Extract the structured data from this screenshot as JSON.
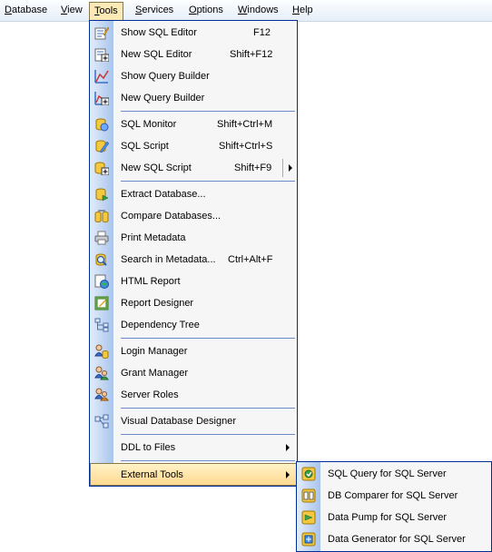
{
  "menubar": {
    "items": [
      {
        "accel": "D",
        "rest": "atabase"
      },
      {
        "accel": "V",
        "rest": "iew"
      },
      {
        "accel": "T",
        "rest": "ools"
      },
      {
        "accel": "S",
        "rest": "ervices"
      },
      {
        "accel": "O",
        "rest": "ptions"
      },
      {
        "accel": "W",
        "rest": "indows"
      },
      {
        "accel": "H",
        "rest": "elp"
      }
    ]
  },
  "tools_menu": {
    "items": [
      {
        "label": "Show SQL Editor",
        "shortcut": "F12",
        "icon": "sql-editor-icon"
      },
      {
        "label": "New SQL Editor",
        "shortcut": "Shift+F12",
        "icon": "new-sql-editor-icon"
      },
      {
        "label": "Show Query Builder",
        "shortcut": "",
        "icon": "query-builder-icon"
      },
      {
        "label": "New Query Builder",
        "shortcut": "",
        "icon": "new-query-builder-icon"
      },
      {
        "label": "SQL Monitor",
        "shortcut": "Shift+Ctrl+M",
        "icon": "sql-monitor-icon"
      },
      {
        "label": "SQL Script",
        "shortcut": "Shift+Ctrl+S",
        "icon": "sql-script-icon"
      },
      {
        "label": "New SQL Script",
        "shortcut": "Shift+F9",
        "icon": "new-sql-script-icon"
      },
      {
        "label": "Extract Database...",
        "shortcut": "",
        "icon": "extract-database-icon"
      },
      {
        "label": "Compare Databases...",
        "shortcut": "",
        "icon": "compare-databases-icon"
      },
      {
        "label": "Print Metadata",
        "shortcut": "",
        "icon": "print-metadata-icon"
      },
      {
        "label": "Search in Metadata...",
        "shortcut": "Ctrl+Alt+F",
        "icon": "search-metadata-icon"
      },
      {
        "label": "HTML Report",
        "shortcut": "",
        "icon": "html-report-icon"
      },
      {
        "label": "Report Designer",
        "shortcut": "",
        "icon": "report-designer-icon"
      },
      {
        "label": "Dependency Tree",
        "shortcut": "",
        "icon": "dependency-tree-icon"
      },
      {
        "label": "Login Manager",
        "shortcut": "",
        "icon": "login-manager-icon"
      },
      {
        "label": "Grant Manager",
        "shortcut": "",
        "icon": "grant-manager-icon"
      },
      {
        "label": "Server Roles",
        "shortcut": "",
        "icon": "server-roles-icon"
      },
      {
        "label": "Visual Database Designer",
        "shortcut": "",
        "icon": "visual-designer-icon"
      },
      {
        "label": "DDL to Files",
        "shortcut": "",
        "icon": ""
      },
      {
        "label": "External Tools",
        "shortcut": "",
        "icon": ""
      }
    ]
  },
  "external_tools_submenu": {
    "items": [
      {
        "label": "SQL Query for SQL Server",
        "icon": "sql-query-app-icon"
      },
      {
        "label": "DB Comparer for SQL Server",
        "icon": "db-comparer-app-icon"
      },
      {
        "label": "Data Pump for SQL Server",
        "icon": "data-pump-app-icon"
      },
      {
        "label": "Data Generator for SQL Server",
        "icon": "data-generator-app-icon"
      }
    ]
  },
  "colors": {
    "menu_border": "#002d96",
    "gutter_light": "#e3edfb",
    "gutter_dark": "#a8c4ec",
    "highlight": "#ffd890",
    "separator": "#6a8ccb"
  }
}
